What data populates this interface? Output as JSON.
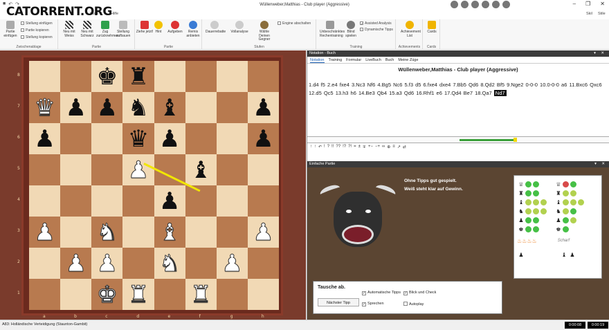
{
  "app": {
    "title": "Wüllenweber,Matthias - Club player (Aggressive)",
    "logo": "CATORRENT.ORG"
  },
  "menu": {
    "tab_start": "Start",
    "tab_help": "Hilfe",
    "right1": "Skil",
    "right2": "Stile"
  },
  "ribbon": {
    "clipboard": {
      "label": "Zwischenablage",
      "paste": "Partie einfügen",
      "pos_insert": "Stellung einfügen",
      "copy_game": "Partie kopieren",
      "copy_pos": "Stellung kopieren"
    },
    "partie": {
      "label": "Partie",
      "new_white": "Neu mit Weiss",
      "new_black": "Neu mit Schwarz",
      "back": "Zug zurücknehmen",
      "setup": "Stellung aufbauen"
    },
    "partie2": {
      "label": "Partie",
      "move_now": "Ziehe jetzt!",
      "hint": "Hint",
      "resign": "Aufgeben",
      "draw": "Remis anbieten"
    },
    "stufen": {
      "label": "Stufen",
      "quick": "Dauerrebatte",
      "full": "Vollanalyse",
      "choose": "Wähle Deinen Gegner",
      "engine_off": "Engine abschalten"
    },
    "training": {
      "label": "Training",
      "unlimited": "Unbeschränktes Rechentraining",
      "blind": "Blind spielen",
      "assisted": "Assisted Analysis",
      "dynamic": "Dynamische Tipps"
    },
    "ach": {
      "label": "Achievements",
      "list": "Achievement List"
    },
    "cards": {
      "label": "Cards",
      "cards": "Cards"
    }
  },
  "notation": {
    "header": "Notation - Buch",
    "tabs": [
      "Notation",
      "Training",
      "Formular",
      "LiveBuch",
      "Buch",
      "Meine Züge"
    ],
    "game_title": "Wüllenweber,Matthias - Club player (Aggressive)",
    "moves": "1.d4 f5 2.e4 fxe4 3.Nc3 Nf6 4.Bg5 Nc6 5.f3 d5 6.fxe4 dxe4 7.Bb5 Qd6 8.Qd2 Bf5 9.Nge2 0-0-0 10.0-0-0 a6 11.Bxc6 Qxc6 12.d5 Qc5 13.h3 h6 14.Be3 Qb4 15.a3 Qd6 16.Rhf1 e6 17.Qd4 Be7 18.Qa7",
    "current_move": "Nd7"
  },
  "trainer": {
    "header": "Einfache Partie",
    "message_line1": "Ohne Tipps gut gespielt.",
    "message_line2": "Weiß steht klar auf Gewinn.",
    "tip_title": "Tausche ab.",
    "next_tip": "Nächster Tipp",
    "opt_auto": "Automatische Tipps",
    "opt_check": "Blick und Check",
    "opt_speak": "Sprechen",
    "opt_autoplay": "Autoplay",
    "sharp": "Scharf"
  },
  "status": {
    "opening": "A83: Holländische Verteidigung (Staunton-Gambit)",
    "clock_white": "0:00:08",
    "clock_black": "0:00:19"
  },
  "board": {
    "ranks": [
      "8",
      "7",
      "6",
      "5",
      "4",
      "3",
      "2",
      "1"
    ],
    "files": [
      "a",
      "b",
      "c",
      "d",
      "e",
      "f",
      "g",
      "h"
    ],
    "pieces": {
      "c8": "♚",
      "d8": "♜",
      "a7": "♕",
      "b7": "♟",
      "c7": "♟",
      "d7": "♞",
      "e7": "♝",
      "h7": "♟",
      "a6": "♟",
      "d6": "♛",
      "e6": "♟",
      "h6": "♟",
      "d5": "♙",
      "f5": "♝",
      "e4": "♟",
      "a3": "♙",
      "c3": "♘",
      "e3": "♗",
      "h3": "♙",
      "b2": "♙",
      "c2": "♙",
      "e2": "♘",
      "g2": "♙",
      "c1": "♔",
      "d1": "♖",
      "f1": "♖"
    }
  }
}
